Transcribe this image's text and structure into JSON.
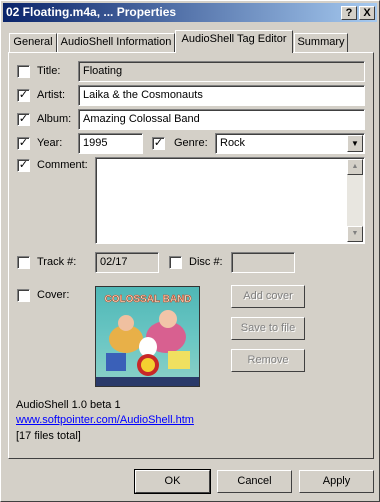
{
  "window": {
    "title": "02 Floating.m4a, ... Properties",
    "help_label": "?",
    "close_label": "X"
  },
  "tabs": [
    {
      "label": "General"
    },
    {
      "label": "AudioShell Information"
    },
    {
      "label": "AudioShell Tag Editor",
      "active": true
    },
    {
      "label": "Summary"
    }
  ],
  "fields": {
    "title": {
      "label": "Title:",
      "value": "Floating",
      "checked": false
    },
    "artist": {
      "label": "Artist:",
      "value": "Laika & the Cosmonauts",
      "checked": true
    },
    "album": {
      "label": "Album:",
      "value": "Amazing Colossal Band",
      "checked": true
    },
    "year": {
      "label": "Year:",
      "value": "1995",
      "checked": true
    },
    "genre": {
      "label": "Genre:",
      "value": "Rock",
      "checked": true
    },
    "comment": {
      "label": "Comment:",
      "value": "",
      "checked": true
    },
    "track": {
      "label": "Track #:",
      "value": "02/17",
      "checked": false
    },
    "disc": {
      "label": "Disc #:",
      "value": "",
      "checked": false
    },
    "cover": {
      "label": "Cover:",
      "checked": false
    }
  },
  "cover_art": {
    "band_text": "COLOSSAL BAND"
  },
  "cover_buttons": {
    "add": "Add cover",
    "save": "Save to file",
    "remove": "Remove"
  },
  "footer": {
    "version": "AudioShell 1.0 beta 1",
    "url": "www.softpointer.com/AudioShell.htm",
    "files_total": "[17 files total]"
  },
  "dialog_buttons": {
    "ok": "OK",
    "cancel": "Cancel",
    "apply": "Apply"
  },
  "icons": {
    "check": "✓",
    "dropdown": "▼",
    "scroll_up": "▲",
    "scroll_down": "▼"
  }
}
